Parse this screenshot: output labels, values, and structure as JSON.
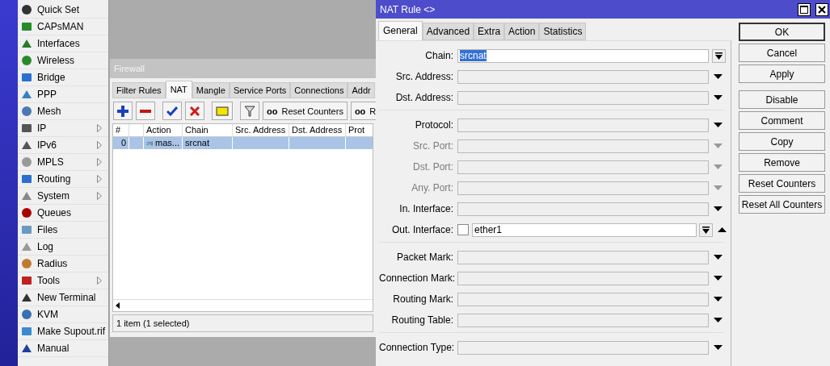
{
  "sidebar": {
    "items": [
      {
        "label": "Quick Set",
        "submenu": false
      },
      {
        "label": "CAPsMAN",
        "submenu": false
      },
      {
        "label": "Interfaces",
        "submenu": false
      },
      {
        "label": "Wireless",
        "submenu": false
      },
      {
        "label": "Bridge",
        "submenu": false
      },
      {
        "label": "PPP",
        "submenu": false
      },
      {
        "label": "Mesh",
        "submenu": false
      },
      {
        "label": "IP",
        "submenu": true
      },
      {
        "label": "IPv6",
        "submenu": true
      },
      {
        "label": "MPLS",
        "submenu": true
      },
      {
        "label": "Routing",
        "submenu": true
      },
      {
        "label": "System",
        "submenu": true
      },
      {
        "label": "Queues",
        "submenu": false
      },
      {
        "label": "Files",
        "submenu": false
      },
      {
        "label": "Log",
        "submenu": false
      },
      {
        "label": "Radius",
        "submenu": false
      },
      {
        "label": "Tools",
        "submenu": true
      },
      {
        "label": "New Terminal",
        "submenu": false
      },
      {
        "label": "KVM",
        "submenu": false
      },
      {
        "label": "Make Supout.rif",
        "submenu": false
      },
      {
        "label": "Manual",
        "submenu": false
      }
    ]
  },
  "firewall": {
    "title": "Firewall",
    "tabs": [
      {
        "label": "Filter Rules",
        "selected": false
      },
      {
        "label": "NAT",
        "selected": true
      },
      {
        "label": "Mangle",
        "selected": false
      },
      {
        "label": "Service Ports",
        "selected": false
      },
      {
        "label": "Connections",
        "selected": false
      },
      {
        "label": "Addr",
        "selected": false
      }
    ],
    "toolbar": {
      "counter_glyph": "oo",
      "reset_counters": "Reset Counters",
      "reset_all_glyph": "oo",
      "reset_all": "R"
    },
    "columns": [
      "#",
      "Action",
      "Chain",
      "Src. Address",
      "Dst. Address",
      "Prot"
    ],
    "rows": [
      {
        "number": "0",
        "action": "mas...",
        "chain": "srcnat",
        "selected": true
      }
    ],
    "status": "1 item (1 selected)"
  },
  "nat_rule": {
    "title": "NAT Rule <>",
    "tabs": [
      {
        "label": "General",
        "selected": true
      },
      {
        "label": "Advanced",
        "selected": false
      },
      {
        "label": "Extra",
        "selected": false
      },
      {
        "label": "Action",
        "selected": false
      },
      {
        "label": "Statistics",
        "selected": false
      }
    ],
    "groups": [
      [
        {
          "kind": "select",
          "label": "Chain:",
          "value": "srcnat",
          "highlighted": true,
          "disabled": false
        },
        {
          "kind": "text",
          "label": "Src. Address:",
          "disabled": false
        },
        {
          "kind": "text",
          "label": "Dst. Address:",
          "disabled": false
        }
      ],
      [
        {
          "kind": "text",
          "label": "Protocol:",
          "disabled": false
        },
        {
          "kind": "text",
          "label": "Src. Port:",
          "disabled": true
        },
        {
          "kind": "text",
          "label": "Dst. Port:",
          "disabled": true
        },
        {
          "kind": "text",
          "label": "Any. Port:",
          "disabled": true
        },
        {
          "kind": "text",
          "label": "In. Interface:",
          "disabled": false
        },
        {
          "kind": "interface",
          "label": "Out. Interface:",
          "value": "ether1",
          "checked": false,
          "expanded": true,
          "disabled": false
        }
      ],
      [
        {
          "kind": "text",
          "label": "Packet Mark:",
          "disabled": false
        },
        {
          "kind": "text",
          "label": "Connection Mark:",
          "disabled": false
        },
        {
          "kind": "text",
          "label": "Routing Mark:",
          "disabled": false
        },
        {
          "kind": "text",
          "label": "Routing Table:",
          "disabled": false
        }
      ],
      [
        {
          "kind": "text",
          "label": "Connection Type:",
          "disabled": false
        }
      ]
    ],
    "button_groups": [
      [
        {
          "label": "OK",
          "default": true
        },
        {
          "label": "Cancel",
          "default": false
        },
        {
          "label": "Apply",
          "default": false
        }
      ],
      [
        {
          "label": "Disable",
          "default": false
        },
        {
          "label": "Comment",
          "default": false
        },
        {
          "label": "Copy",
          "default": false
        },
        {
          "label": "Remove",
          "default": false
        },
        {
          "label": "Reset Counters",
          "default": false
        },
        {
          "label": "Reset All Counters",
          "default": false
        }
      ]
    ]
  }
}
